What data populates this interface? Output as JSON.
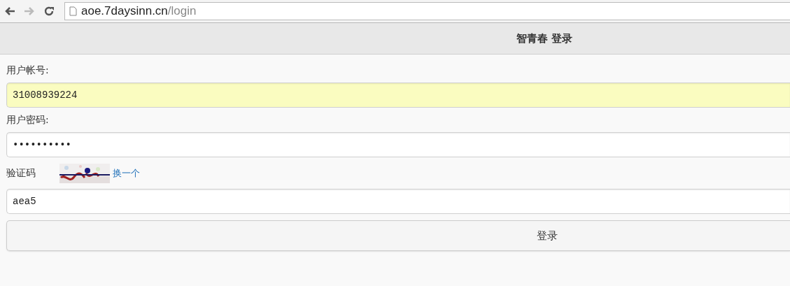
{
  "browser": {
    "url_host": "aoe.7daysinn.cn",
    "url_path": "/login"
  },
  "header": {
    "title": "智青春 登录"
  },
  "form": {
    "fields": [
      {
        "label": "用户帐号:",
        "value": "31008939224",
        "autofilled": true
      },
      {
        "label": "用户密码:",
        "value": "••••••••••",
        "autofilled": false
      }
    ],
    "captcha": {
      "label": "验证码",
      "refresh_link": "换一个",
      "value": "aea5"
    },
    "submit": "登录"
  }
}
